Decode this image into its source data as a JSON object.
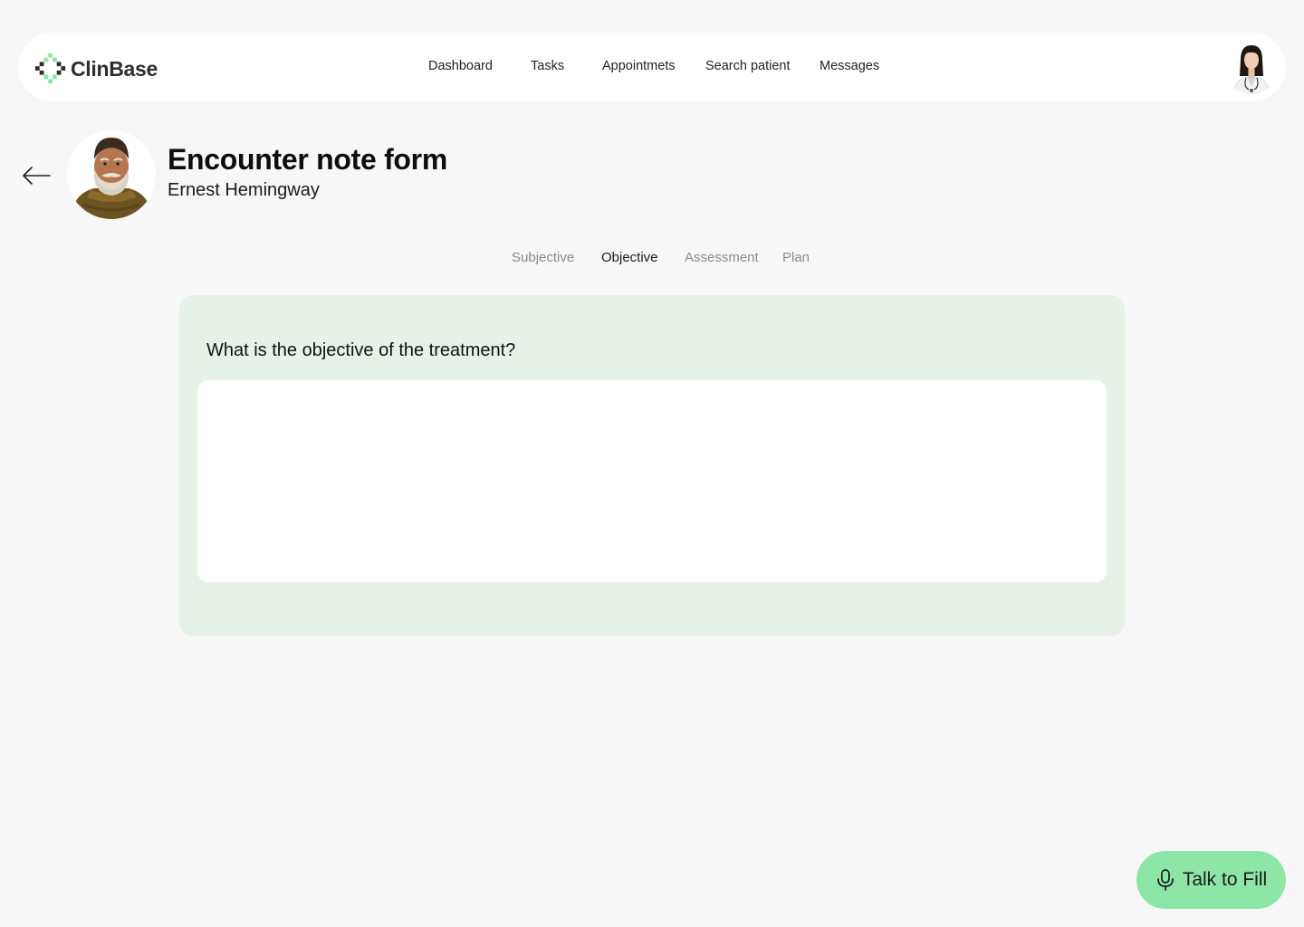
{
  "brand": {
    "name": "ClinBase",
    "accent_color": "#8ee6a6",
    "logo_icon": "clinbase-cross-logo-icon"
  },
  "nav": {
    "items": [
      {
        "label": "Dashboard"
      },
      {
        "label": "Tasks"
      },
      {
        "label": "Appointmets"
      },
      {
        "label": "Search patient"
      },
      {
        "label": "Messages"
      }
    ],
    "user_avatar": "doctor-avatar"
  },
  "header": {
    "back_icon": "arrow-left-icon",
    "title": "Encounter note form",
    "patient_name": "Ernest Hemingway",
    "patient_photo": "patient-photo"
  },
  "tabs": [
    {
      "label": "Subjective",
      "active": false
    },
    {
      "label": "Objective",
      "active": true
    },
    {
      "label": "Assessment",
      "active": false
    },
    {
      "label": "Plan",
      "active": false
    }
  ],
  "form": {
    "question": "What is the objective of the treatment?",
    "answer_value": "",
    "card_color": "#e7f1e7"
  },
  "talk_button": {
    "label": "Talk to Fill",
    "icon": "microphone-icon"
  }
}
